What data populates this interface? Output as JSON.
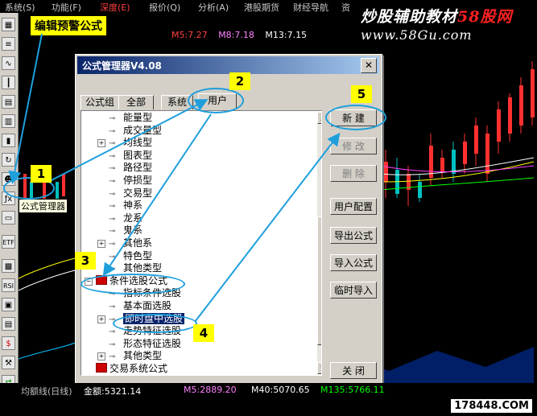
{
  "menubar": {
    "items": [
      "系统(S)",
      "功能(F)",
      "深度(E)",
      "报价(Q)",
      "分析(A)",
      "港股期货",
      "财经导航",
      "资"
    ]
  },
  "moving_averages": {
    "ma5": "M5:7.27",
    "ma8": "M8:7.18",
    "ma13": "M13:7.15"
  },
  "watermark": {
    "line1_a": "炒股辅助教材",
    "line1_b": "58股网",
    "line2": "www.58Gu.com"
  },
  "annotation": {
    "edit_alert_formula": "编辑预警公式",
    "tooltip": "公式管理器",
    "badges": [
      "1",
      "2",
      "3",
      "4",
      "5"
    ]
  },
  "dialog": {
    "title": "公式管理器V4.08",
    "close": "✕",
    "tabs": [
      "公式组",
      "全部",
      "系统",
      "用户"
    ],
    "tree": [
      {
        "label": "能量型",
        "level": 2,
        "expandable": false
      },
      {
        "label": "成交量型",
        "level": 2,
        "expandable": false
      },
      {
        "label": "均线型",
        "level": 2,
        "expandable": true
      },
      {
        "label": "图表型",
        "level": 2,
        "expandable": false
      },
      {
        "label": "路径型",
        "level": 2,
        "expandable": false
      },
      {
        "label": "停损型",
        "level": 2,
        "expandable": false
      },
      {
        "label": "交易型",
        "level": 2,
        "expandable": false
      },
      {
        "label": "神系",
        "level": 2,
        "expandable": false
      },
      {
        "label": "龙系",
        "level": 2,
        "expandable": false
      },
      {
        "label": "鬼系",
        "level": 2,
        "expandable": false
      },
      {
        "label": "其他系",
        "level": 2,
        "expandable": true
      },
      {
        "label": "特色型",
        "level": 2,
        "expandable": false
      },
      {
        "label": "其他类型",
        "level": 2,
        "expandable": false
      },
      {
        "label": "条件选股公式",
        "level": 1,
        "expandable": true,
        "folder": true
      },
      {
        "label": "指标条件选股",
        "level": 2,
        "expandable": false
      },
      {
        "label": "基本面选股",
        "level": 2,
        "expandable": false
      },
      {
        "label": "即时盘中选股",
        "level": 2,
        "expandable": true,
        "selected": true
      },
      {
        "label": "走势特征选股",
        "level": 2,
        "expandable": false
      },
      {
        "label": "形态特征选股",
        "level": 2,
        "expandable": false
      },
      {
        "label": "其他类型",
        "level": 2,
        "expandable": true
      },
      {
        "label": "交易系统公式",
        "level": 1,
        "expandable": false,
        "folder": true
      }
    ],
    "buttons": {
      "new": "新  建",
      "modify": "修  改",
      "delete": "删  除",
      "user_config": "用户配置",
      "export": "导出公式",
      "import": "导入公式",
      "temp_import": "临时导入",
      "close": "关  闭"
    }
  },
  "bottom": {
    "indicator": "均额线(日线)",
    "amount": "金额:5321.14",
    "m5": "M5:2889.20",
    "m40": "M40:5070.65",
    "m135": "M135:5766.11",
    "site": "178448.COM"
  },
  "colors": {
    "titlebar": "#0a246a",
    "annotation_blue": "#1e9fdc",
    "badge_yellow": "#ffff00"
  }
}
